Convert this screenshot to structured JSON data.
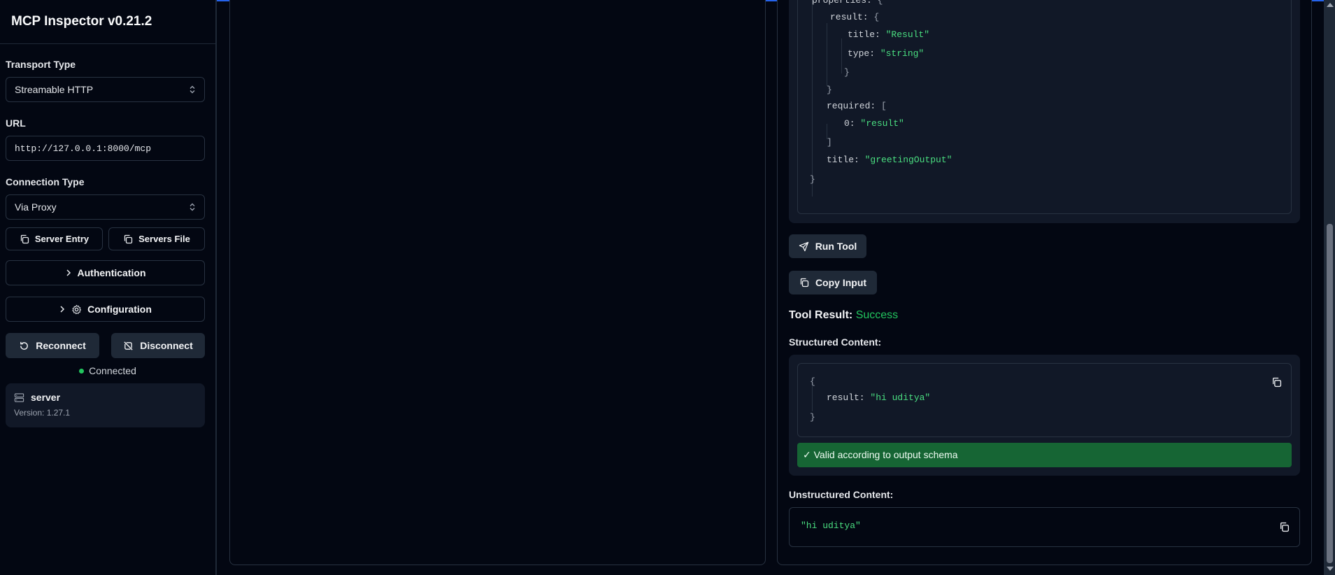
{
  "sidebar": {
    "title": "MCP Inspector v0.21.2",
    "transport_label": "Transport Type",
    "transport_value": "Streamable HTTP",
    "url_label": "URL",
    "url_value": "http://127.0.0.1:8000/mcp",
    "connection_label": "Connection Type",
    "connection_value": "Via Proxy",
    "server_entry_label": "Server Entry",
    "servers_file_label": "Servers File",
    "authentication_label": "Authentication",
    "configuration_label": "Configuration",
    "reconnect_label": "Reconnect",
    "disconnect_label": "Disconnect",
    "status_text": "Connected",
    "status_color": "#22c55e",
    "server_name": "server",
    "server_version": "Version: 1.27.1"
  },
  "schema": {
    "properties_key": "properties:",
    "result_key": "result:",
    "title_key": "title:",
    "title_value": "\"Result\"",
    "type_key": "type:",
    "type_value": "\"string\"",
    "required_key": "required:",
    "index_key": "0:",
    "required_value": "\"result\"",
    "schema_title_key": "title:",
    "schema_title_value": "\"greetingOutput\""
  },
  "tool": {
    "run_label": "Run Tool",
    "copy_input_label": "Copy Input",
    "result_title": "Tool Result:",
    "result_status": "Success",
    "structured_label": "Structured Content:",
    "structured_key": "result:",
    "structured_value": "\"hi uditya\"",
    "valid_text": "✓ Valid according to output schema",
    "unstructured_label": "Unstructured Content:",
    "unstructured_value": "\"hi uditya\""
  },
  "colors": {
    "accent": "#2563eb",
    "success": "#22c55e",
    "valid_bg": "#166534",
    "json_string": "#4ade80"
  }
}
